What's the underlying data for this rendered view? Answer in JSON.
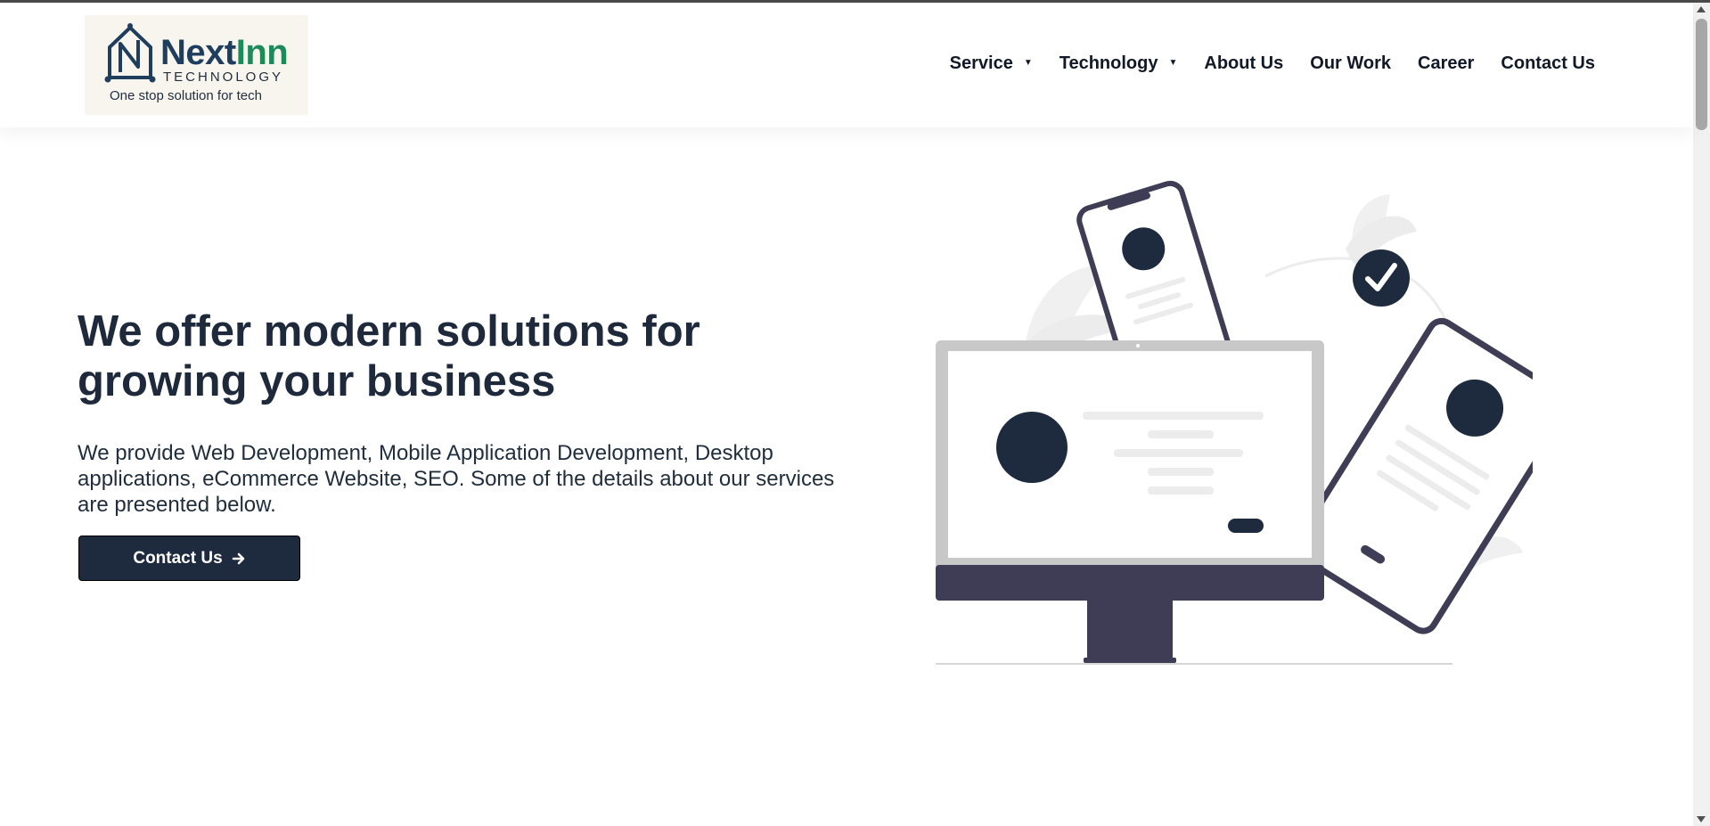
{
  "logo": {
    "name_part1": "Next",
    "name_part2": "Inn",
    "sub": "TECHNOLOGY",
    "tagline": "One stop solution for tech"
  },
  "nav": {
    "items": [
      {
        "label": "Service",
        "dropdown": true
      },
      {
        "label": "Technology",
        "dropdown": true
      },
      {
        "label": "About Us",
        "dropdown": false
      },
      {
        "label": "Our Work",
        "dropdown": false
      },
      {
        "label": "Career",
        "dropdown": false
      },
      {
        "label": "Contact Us",
        "dropdown": false
      }
    ]
  },
  "hero": {
    "title": "We offer modern solutions for growing your business",
    "description": "We provide Web Development, Mobile Application Development, Desktop applications, eCommerce Website, SEO. Some of the details about our services are presented below.",
    "cta_label": "Contact Us",
    "cta_icon": "arrow-right-icon"
  },
  "colors": {
    "primary": "#1e2b3e",
    "brand_blue": "#1f3d5c",
    "brand_green": "#1d8a5a",
    "illustration_dark": "#3f3d56",
    "illustration_accent": "#1e2b3e"
  }
}
